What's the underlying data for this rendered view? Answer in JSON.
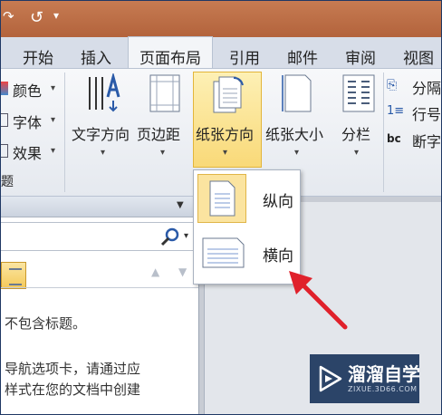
{
  "tabs": [
    "开始",
    "插入",
    "页面布局",
    "引用",
    "邮件",
    "审阅",
    "视图"
  ],
  "theme_group": {
    "colors": "颜色",
    "fonts": "字体",
    "effects": "效果",
    "group_label": "题"
  },
  "ribbon_buttons": [
    "文字方向",
    "页边距",
    "纸张方向",
    "纸张大小",
    "分栏"
  ],
  "right_items": [
    "分隔",
    "行号",
    "断字"
  ],
  "orientation_menu": {
    "portrait": "纵向",
    "landscape": "横向"
  },
  "nav_pane": {
    "lines": [
      "不包含标题。",
      "导航选项卡，请通过应",
      "样式在您的文档中创建"
    ]
  },
  "watermark": {
    "brand": "溜溜自学",
    "url": "ZIXUE.3D66.COM"
  },
  "colors": {
    "accent": "#f9e79f",
    "title_bar": "#b8683f",
    "arrow": "#e0212b"
  }
}
